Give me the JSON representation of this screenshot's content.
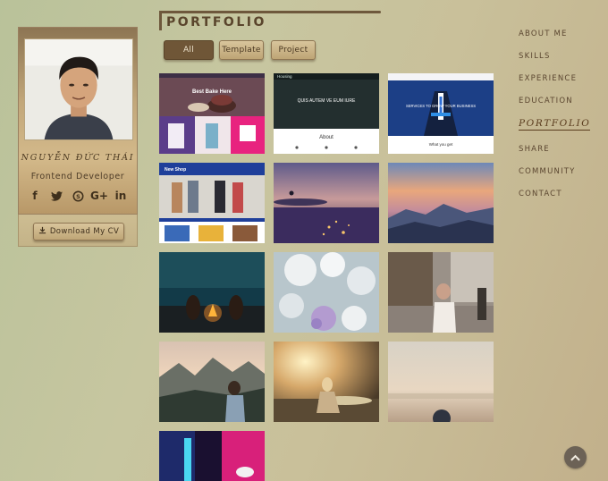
{
  "profile": {
    "name": "NGUYỄN ĐỨC THÁI",
    "role": "Frontend Developer",
    "socials": [
      "facebook-icon",
      "twitter-icon",
      "skype-icon",
      "google-plus-icon",
      "linkedin-icon"
    ],
    "social_glyphs": [
      "f",
      "🐦",
      "S",
      "G+",
      "in"
    ],
    "cv_label": "Download My CV"
  },
  "header": {
    "title": "PORTFOLIO"
  },
  "filters": [
    {
      "label": "All",
      "active": true
    },
    {
      "label": "Template",
      "active": false
    },
    {
      "label": "Project",
      "active": false
    }
  ],
  "tiles": [
    {
      "name": "tile-bakery-template",
      "caption": "Best Bake Here"
    },
    {
      "name": "tile-housing-template",
      "caption": "QUIS AUTEM VE EUM IURE",
      "brand": "Housing",
      "section": "About"
    },
    {
      "name": "tile-business-template",
      "caption": "SERVICES TO GROW YOUR BUSINESS",
      "sub": "What you get"
    },
    {
      "name": "tile-newshop-template",
      "brand": "New Shop"
    },
    {
      "name": "tile-lavender-photo"
    },
    {
      "name": "tile-mountain-sunset-photo"
    },
    {
      "name": "tile-campfire-photo"
    },
    {
      "name": "tile-cotton-flowers-photo"
    },
    {
      "name": "tile-street-cafe-photo"
    },
    {
      "name": "tile-mountain-girl-photo"
    },
    {
      "name": "tile-lake-sunset-photo"
    },
    {
      "name": "tile-city-haze-photo"
    },
    {
      "name": "tile-neon-photo"
    }
  ],
  "nav": [
    {
      "label": "ABOUT ME",
      "active": false
    },
    {
      "label": "SKILLS",
      "active": false
    },
    {
      "label": "EXPERIENCE",
      "active": false
    },
    {
      "label": "EDUCATION",
      "active": false
    },
    {
      "label": "PORTFOLIO",
      "active": true
    },
    {
      "label": "SHARE",
      "active": false
    },
    {
      "label": "COMMUNITY",
      "active": false
    },
    {
      "label": "CONTACT",
      "active": false
    }
  ],
  "colors": {
    "accent": "#6f5637",
    "background": "#c7c6a0",
    "text": "#5b4630"
  },
  "scroll_top_icon": "chevron-up-icon"
}
